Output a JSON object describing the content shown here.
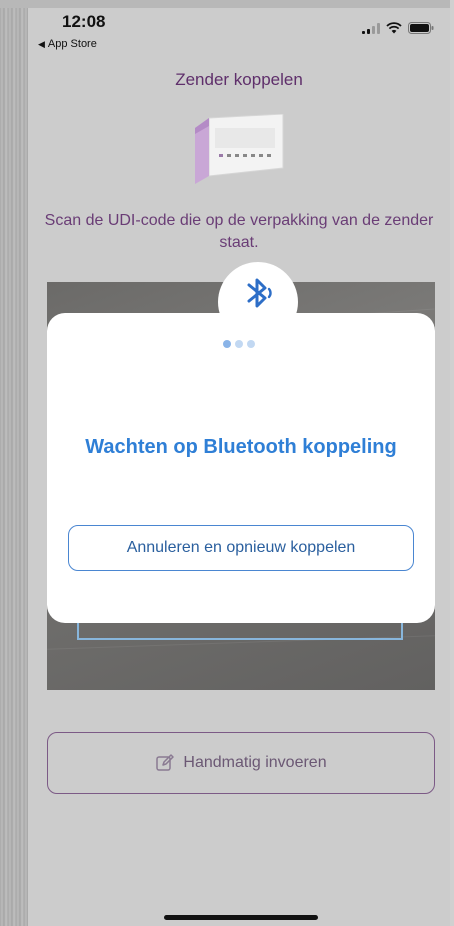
{
  "status_bar": {
    "time": "12:08",
    "back_label": "App Store",
    "icons": [
      "signal-icon",
      "wifi-icon",
      "battery-icon"
    ]
  },
  "page": {
    "title": "Zender koppelen",
    "instruction": "Scan de UDI-code die op de verpakking van de zender staat."
  },
  "modal": {
    "icon": "bluetooth-icon",
    "dots_total": 3,
    "dots_active": 1,
    "heading": "Wachten op Bluetooth koppeling",
    "retry_label": "Annuleren en opnieuw koppelen"
  },
  "manual_entry": {
    "icon": "edit-icon",
    "label": "Handmatig invoeren"
  },
  "colors": {
    "accent_blue": "#2f7fd6",
    "brand_purple": "#5f2f6b",
    "overlay_gray": "#cccccc"
  }
}
